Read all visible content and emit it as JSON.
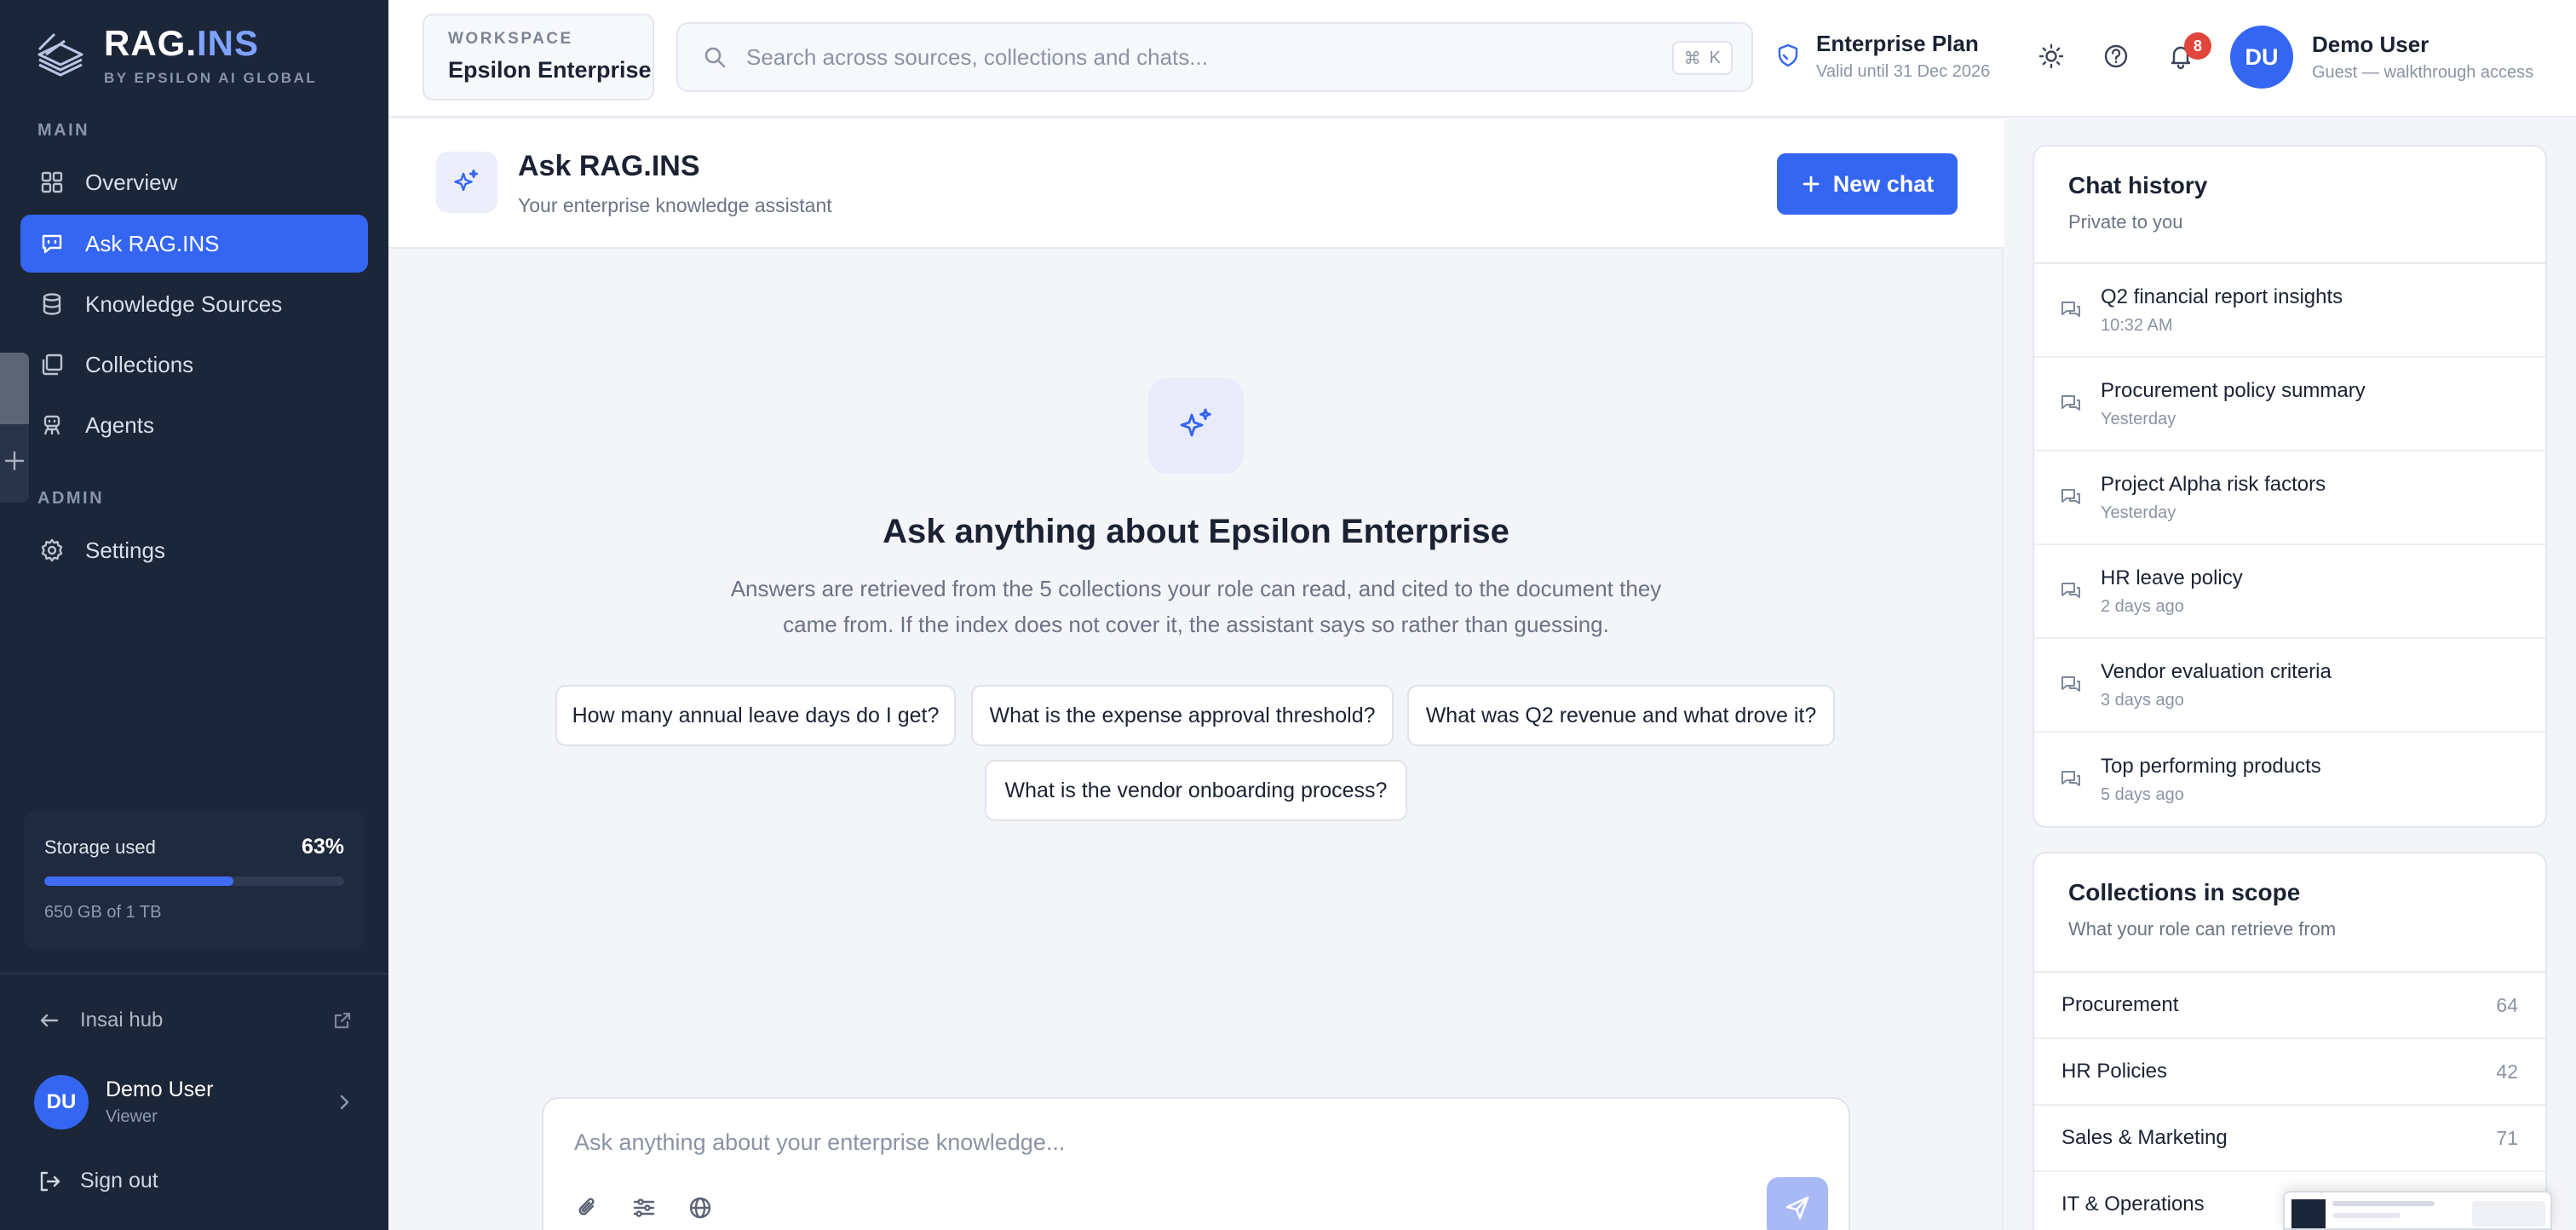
{
  "brand": {
    "name_prefix": "RAG.",
    "name_suffix": "INS",
    "subtitle": "BY EPSILON AI GLOBAL"
  },
  "sidebar": {
    "section_main": "MAIN",
    "section_admin": "ADMIN",
    "items": [
      {
        "label": "Overview",
        "icon": "grid-icon",
        "active": false
      },
      {
        "label": "Ask RAG.INS",
        "icon": "chat-icon",
        "active": true
      },
      {
        "label": "Knowledge Sources",
        "icon": "database-icon",
        "active": false
      },
      {
        "label": "Collections",
        "icon": "collections-icon",
        "active": false
      },
      {
        "label": "Agents",
        "icon": "agent-icon",
        "active": false
      }
    ],
    "admin_items": [
      {
        "label": "Settings",
        "icon": "gear-icon"
      }
    ],
    "storage": {
      "label": "Storage used",
      "percent_label": "63%",
      "fraction": 0.63,
      "detail": "650 GB of 1 TB"
    },
    "hub_label": "Insai hub",
    "user": {
      "initials": "DU",
      "name": "Demo User",
      "role": "Viewer"
    },
    "sign_out": "Sign out"
  },
  "topbar": {
    "workspace_label": "WORKSPACE",
    "workspace_name": "Epsilon Enterprise",
    "search_placeholder": "Search across sources, collections and chats...",
    "shortcut_symbol": "⌘",
    "shortcut_key": "K",
    "plan_title": "Enterprise Plan",
    "plan_valid": "Valid until 31 Dec 2026",
    "notification_count": "8",
    "user": {
      "initials": "DU",
      "name": "Demo User",
      "subtitle": "Guest — walkthrough access"
    }
  },
  "main": {
    "title": "Ask RAG.INS",
    "subtitle": "Your enterprise knowledge assistant",
    "new_chat": "New chat",
    "hero_title": "Ask anything about Epsilon Enterprise",
    "hero_desc": "Answers are retrieved from the 5 collections your role can read, and cited to the document they came from. If the index does not cover it, the assistant says so rather than guessing.",
    "suggestions": [
      "How many annual leave days do I get?",
      "What is the expense approval threshold?",
      "What was Q2 revenue and what drove it?",
      "What is the vendor onboarding process?"
    ],
    "composer_placeholder": "Ask anything about your enterprise knowledge..."
  },
  "history": {
    "title": "Chat history",
    "subtitle": "Private to you",
    "items": [
      {
        "title": "Q2 financial report insights",
        "time": "10:32 AM"
      },
      {
        "title": "Procurement policy summary",
        "time": "Yesterday"
      },
      {
        "title": "Project Alpha risk factors",
        "time": "Yesterday"
      },
      {
        "title": "HR leave policy",
        "time": "2 days ago"
      },
      {
        "title": "Vendor evaluation criteria",
        "time": "3 days ago"
      },
      {
        "title": "Top performing products",
        "time": "5 days ago"
      }
    ]
  },
  "collections": {
    "title": "Collections in scope",
    "subtitle": "What your role can retrieve from",
    "items": [
      {
        "name": "Procurement",
        "count": "64"
      },
      {
        "name": "HR Policies",
        "count": "42"
      },
      {
        "name": "Sales & Marketing",
        "count": "71"
      },
      {
        "name": "IT & Operations",
        "count": ""
      }
    ]
  },
  "colors": {
    "accent": "#3466f2",
    "sidebar_bg": "#1c2639",
    "badge": "#e0463c"
  }
}
